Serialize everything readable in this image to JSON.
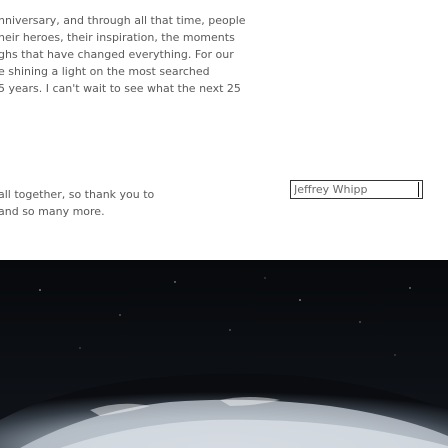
{
  "article": {
    "para1_lines": [
      "nniversary, and through all that time, people",
      "neir heroes, their inspiration, the moments",
      "ghs that have changed everything. For our",
      "e shining a light on the most searched",
      "5 years. I can't wait to see what the next 25"
    ],
    "para2_lines": [
      "all together, so thank you to",
      "and so many more."
    ],
    "inline_input_value": "Jeffrey Whipp"
  },
  "colors": {
    "text": "#5a5a5a",
    "input_border": "#333333",
    "space_bg": "#0a0c10"
  }
}
